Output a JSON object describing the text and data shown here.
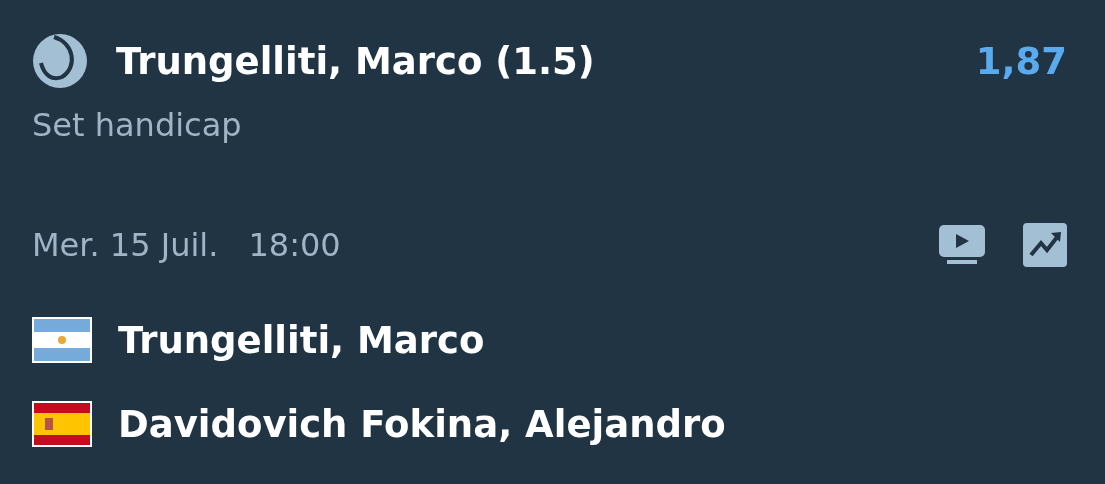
{
  "selection": {
    "name": "Trungelliti, Marco (1.5)",
    "odds": "1,87"
  },
  "market": "Set handicap",
  "event": {
    "date": "Mer. 15 Juil.",
    "time": "18:00"
  },
  "players": [
    {
      "name": "Trungelliti, Marco",
      "kind": "argentina"
    },
    {
      "name": "Davidovich Fokina, Alejandro",
      "kind": "spain"
    }
  ]
}
